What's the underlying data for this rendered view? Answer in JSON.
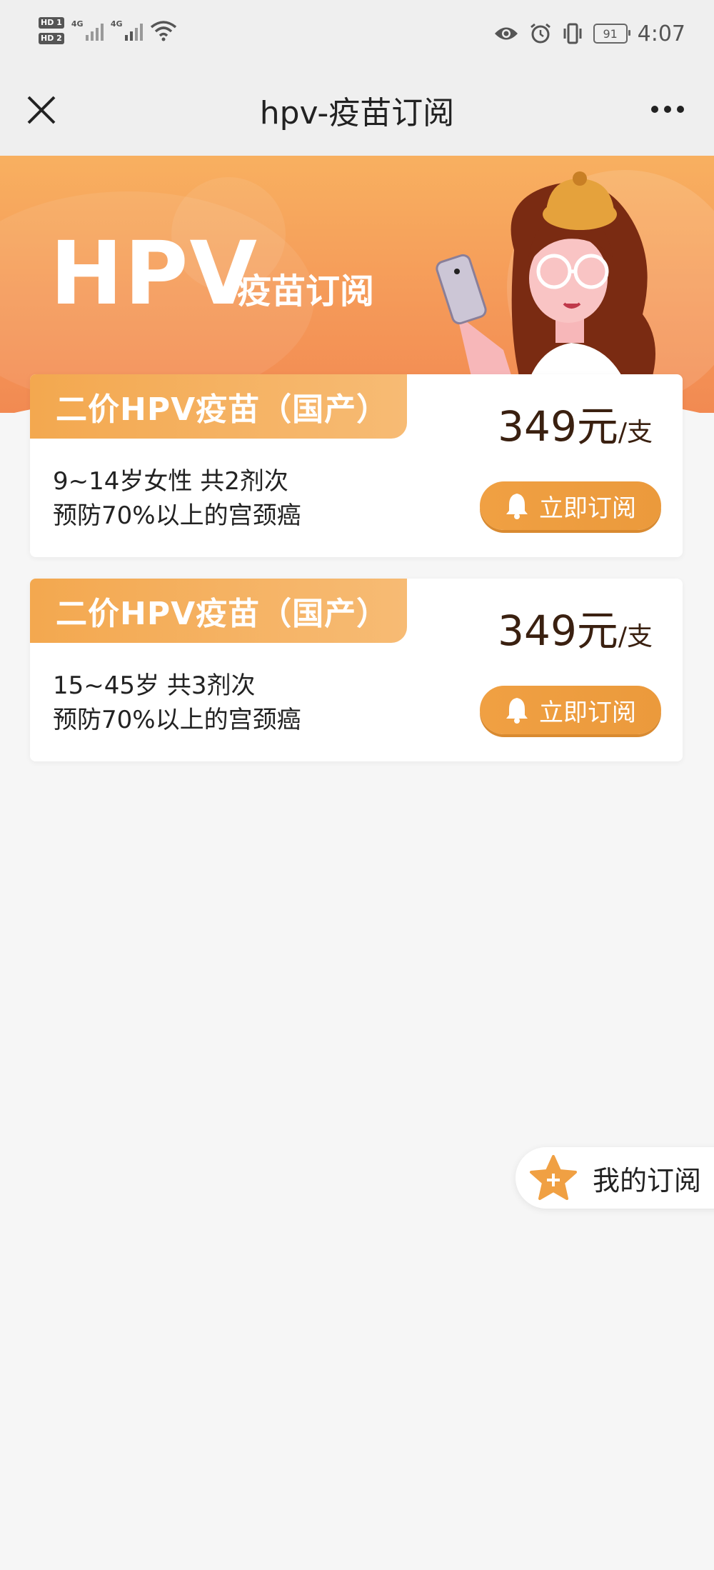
{
  "status_bar": {
    "hd1": "HD 1",
    "hd2": "HD 2",
    "net1": "4G",
    "net2": "4G",
    "battery": "91",
    "time": "4:07"
  },
  "nav": {
    "title": "hpv-疫苗订阅"
  },
  "banner": {
    "big": "HPV",
    "sub": "疫苗订阅"
  },
  "vaccines": [
    {
      "name": "二价HPV疫苗（国产）",
      "price": "349元",
      "unit": "/支",
      "desc1": "9~14岁女性   共2剂次",
      "desc2": "预防70%以上的宫颈癌",
      "button": "立即订阅"
    },
    {
      "name": "二价HPV疫苗（国产）",
      "price": "349元",
      "unit": "/支",
      "desc1": "15~45岁   共3剂次",
      "desc2": "预防70%以上的宫颈癌",
      "button": "立即订阅"
    }
  ],
  "floating": {
    "label": "我的订阅"
  },
  "colors": {
    "accent": "#f3a84f",
    "price": "#3a2010",
    "background": "#f6f6f6"
  }
}
